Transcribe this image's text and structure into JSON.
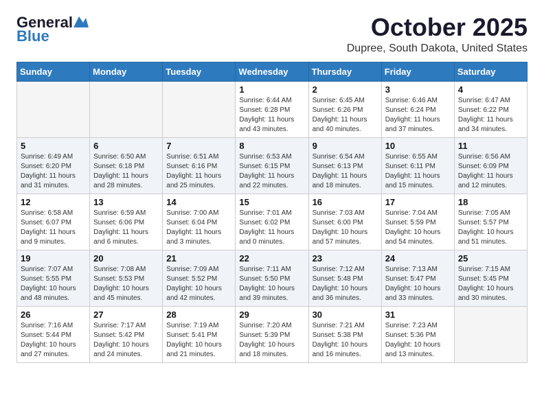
{
  "header": {
    "logo_line1": "General",
    "logo_line2": "Blue",
    "month": "October 2025",
    "location": "Dupree, South Dakota, United States"
  },
  "weekdays": [
    "Sunday",
    "Monday",
    "Tuesday",
    "Wednesday",
    "Thursday",
    "Friday",
    "Saturday"
  ],
  "weeks": [
    [
      {
        "day": "",
        "info": ""
      },
      {
        "day": "",
        "info": ""
      },
      {
        "day": "",
        "info": ""
      },
      {
        "day": "1",
        "info": "Sunrise: 6:44 AM\nSunset: 6:28 PM\nDaylight: 11 hours\nand 43 minutes."
      },
      {
        "day": "2",
        "info": "Sunrise: 6:45 AM\nSunset: 6:26 PM\nDaylight: 11 hours\nand 40 minutes."
      },
      {
        "day": "3",
        "info": "Sunrise: 6:46 AM\nSunset: 6:24 PM\nDaylight: 11 hours\nand 37 minutes."
      },
      {
        "day": "4",
        "info": "Sunrise: 6:47 AM\nSunset: 6:22 PM\nDaylight: 11 hours\nand 34 minutes."
      }
    ],
    [
      {
        "day": "5",
        "info": "Sunrise: 6:49 AM\nSunset: 6:20 PM\nDaylight: 11 hours\nand 31 minutes."
      },
      {
        "day": "6",
        "info": "Sunrise: 6:50 AM\nSunset: 6:18 PM\nDaylight: 11 hours\nand 28 minutes."
      },
      {
        "day": "7",
        "info": "Sunrise: 6:51 AM\nSunset: 6:16 PM\nDaylight: 11 hours\nand 25 minutes."
      },
      {
        "day": "8",
        "info": "Sunrise: 6:53 AM\nSunset: 6:15 PM\nDaylight: 11 hours\nand 22 minutes."
      },
      {
        "day": "9",
        "info": "Sunrise: 6:54 AM\nSunset: 6:13 PM\nDaylight: 11 hours\nand 18 minutes."
      },
      {
        "day": "10",
        "info": "Sunrise: 6:55 AM\nSunset: 6:11 PM\nDaylight: 11 hours\nand 15 minutes."
      },
      {
        "day": "11",
        "info": "Sunrise: 6:56 AM\nSunset: 6:09 PM\nDaylight: 11 hours\nand 12 minutes."
      }
    ],
    [
      {
        "day": "12",
        "info": "Sunrise: 6:58 AM\nSunset: 6:07 PM\nDaylight: 11 hours\nand 9 minutes."
      },
      {
        "day": "13",
        "info": "Sunrise: 6:59 AM\nSunset: 6:06 PM\nDaylight: 11 hours\nand 6 minutes."
      },
      {
        "day": "14",
        "info": "Sunrise: 7:00 AM\nSunset: 6:04 PM\nDaylight: 11 hours\nand 3 minutes."
      },
      {
        "day": "15",
        "info": "Sunrise: 7:01 AM\nSunset: 6:02 PM\nDaylight: 11 hours\nand 0 minutes."
      },
      {
        "day": "16",
        "info": "Sunrise: 7:03 AM\nSunset: 6:00 PM\nDaylight: 10 hours\nand 57 minutes."
      },
      {
        "day": "17",
        "info": "Sunrise: 7:04 AM\nSunset: 5:59 PM\nDaylight: 10 hours\nand 54 minutes."
      },
      {
        "day": "18",
        "info": "Sunrise: 7:05 AM\nSunset: 5:57 PM\nDaylight: 10 hours\nand 51 minutes."
      }
    ],
    [
      {
        "day": "19",
        "info": "Sunrise: 7:07 AM\nSunset: 5:55 PM\nDaylight: 10 hours\nand 48 minutes."
      },
      {
        "day": "20",
        "info": "Sunrise: 7:08 AM\nSunset: 5:53 PM\nDaylight: 10 hours\nand 45 minutes."
      },
      {
        "day": "21",
        "info": "Sunrise: 7:09 AM\nSunset: 5:52 PM\nDaylight: 10 hours\nand 42 minutes."
      },
      {
        "day": "22",
        "info": "Sunrise: 7:11 AM\nSunset: 5:50 PM\nDaylight: 10 hours\nand 39 minutes."
      },
      {
        "day": "23",
        "info": "Sunrise: 7:12 AM\nSunset: 5:48 PM\nDaylight: 10 hours\nand 36 minutes."
      },
      {
        "day": "24",
        "info": "Sunrise: 7:13 AM\nSunset: 5:47 PM\nDaylight: 10 hours\nand 33 minutes."
      },
      {
        "day": "25",
        "info": "Sunrise: 7:15 AM\nSunset: 5:45 PM\nDaylight: 10 hours\nand 30 minutes."
      }
    ],
    [
      {
        "day": "26",
        "info": "Sunrise: 7:16 AM\nSunset: 5:44 PM\nDaylight: 10 hours\nand 27 minutes."
      },
      {
        "day": "27",
        "info": "Sunrise: 7:17 AM\nSunset: 5:42 PM\nDaylight: 10 hours\nand 24 minutes."
      },
      {
        "day": "28",
        "info": "Sunrise: 7:19 AM\nSunset: 5:41 PM\nDaylight: 10 hours\nand 21 minutes."
      },
      {
        "day": "29",
        "info": "Sunrise: 7:20 AM\nSunset: 5:39 PM\nDaylight: 10 hours\nand 18 minutes."
      },
      {
        "day": "30",
        "info": "Sunrise: 7:21 AM\nSunset: 5:38 PM\nDaylight: 10 hours\nand 16 minutes."
      },
      {
        "day": "31",
        "info": "Sunrise: 7:23 AM\nSunset: 5:36 PM\nDaylight: 10 hours\nand 13 minutes."
      },
      {
        "day": "",
        "info": ""
      }
    ]
  ]
}
